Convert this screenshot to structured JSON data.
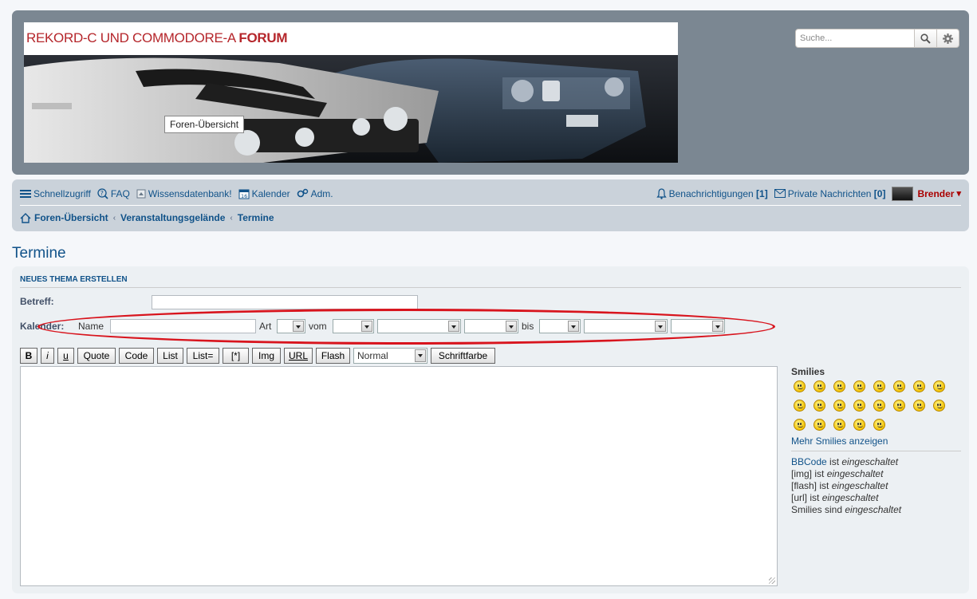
{
  "header": {
    "banner_title_plain": "REKORD-C UND COMMODORE-A ",
    "banner_title_bold": "FORUM",
    "tooltip": "Foren-Übersicht",
    "search_placeholder": "Suche...",
    "search_icon": "magnifier-icon",
    "advanced_icon": "gear-icon"
  },
  "navbar": {
    "items": [
      {
        "icon": "menu-icon",
        "label": "Schnellzugriff"
      },
      {
        "icon": "help-icon",
        "label": "FAQ"
      },
      {
        "icon": "page-icon",
        "label": "Wissensdatenbank!"
      },
      {
        "icon": "calendar-icon",
        "label": "Kalender"
      },
      {
        "icon": "cogs-icon",
        "label": "Adm."
      }
    ],
    "notifications_label": "Benachrichtigungen",
    "notifications_count": "[1]",
    "pm_label": "Private Nachrichten",
    "pm_count": "[0]",
    "username": "Brender",
    "username_caret": "▾"
  },
  "breadcrumbs": [
    "Foren-Übersicht",
    "Veranstaltungsgelände",
    "Termine"
  ],
  "page_title": "Termine",
  "form": {
    "section_title": "NEUES THEMA ERSTELLEN",
    "subject_label": "Betreff:",
    "calendar_label": "Kalender:",
    "name_label": "Name",
    "type_label": "Art",
    "from_label": "vom",
    "to_label": "bis"
  },
  "toolbar": {
    "bold": "B",
    "italic": "i",
    "underline": "u",
    "quote": "Quote",
    "code": "Code",
    "list": "List",
    "list_eq": "List=",
    "list_item": "[*]",
    "img": "Img",
    "url": "URL",
    "flash": "Flash",
    "size_value": "Normal",
    "color": "Schriftfarbe"
  },
  "sidebar": {
    "smilies_title": "Smilies",
    "more_smilies": "Mehr Smilies anzeigen",
    "bbcode_link": "BBCode",
    "options": [
      {
        "prefix": "",
        "mid": " ist ",
        "state": "eingeschaltet"
      },
      {
        "prefix": "[img]",
        "mid": " ist ",
        "state": "eingeschaltet"
      },
      {
        "prefix": "[flash]",
        "mid": " ist ",
        "state": "eingeschaltet"
      },
      {
        "prefix": "[url]",
        "mid": " ist ",
        "state": "eingeschaltet"
      },
      {
        "prefix": "Smilies",
        "mid": " sind ",
        "state": "eingeschaltet"
      }
    ]
  }
}
